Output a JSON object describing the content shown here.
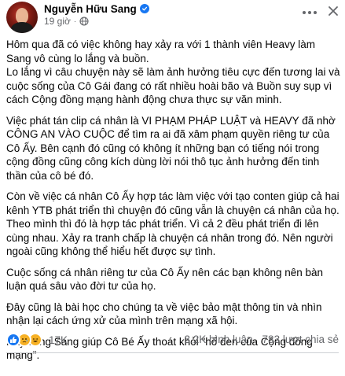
{
  "post": {
    "author": "Nguyễn Hữu Sang",
    "time": "19 giờ",
    "separator": "·",
    "paragraphs": [
      "Hôm qua đã có việc không hay xảy ra với 1 thành viên Heavy làm Sang vô cùng lo lắng và buồn.\nLo lắng vì câu chuyện này sẽ làm ảnh hưởng tiêu cực đến tương lai và cuộc sống của Cô Gái đang có rất nhiều hoài bão và Buồn suy sụp vì cách Cộng đồng mạng hành động chưa thực sự văn minh.",
      "Việc phát tán clip cá nhân là VI PHẠM PHÁP LUẬT và HEAVY đã nhờ CÔNG AN VÀO CUỘC để tìm ra ai đã xâm phạm quyền riêng tư của Cô Ấy. Bên cạnh đó cũng có không ít những bạn có tiếng nói trong cộng đồng cũng công kích dùng lời nói thô tục ảnh hưởng đến tinh thần của cô bé đó.",
      "Còn về việc cá nhân Cô Ấy hợp tác làm việc với tạo conten giúp cả hai kênh YTB phát triển thì chuyện đó cũng vẫn là chuyện cá nhân của họ. Theo mình thì đó là hợp tác phát triển. Vì cả 2 đều phát triển đi lên cùng nhau. Xảy ra tranh chấp là chuyện cá nhân trong đó. Nên người ngoài cũng không thể hiểu hết được sự tình.",
      "Cuộc sống cá nhân riêng tư của Cô Ấy nên các bạn không nên bàn luận quá sâu vào đời tư của họ.",
      "Đây cũng là bài học cho chúng ta về việc bảo mật thông tin và nhìn nhận lại cách ứng xử của mình trên mạng xã hội.",
      "Hãy cùng Sang giúp Cô Bé Ấy thoát khỏi \"hố đen của Cộng đồng mạng\"."
    ]
  },
  "footer": {
    "reaction_count": "17K",
    "comments": "3,2K bình luận",
    "shares": "783 lượt chia sẻ",
    "reaction_icons": [
      "like-icon",
      "sad-icon",
      "haha-icon"
    ]
  },
  "colors": {
    "primary_blue": "#1877f2",
    "secondary_text": "#65676b",
    "reaction_yellow": "#f7b125"
  }
}
